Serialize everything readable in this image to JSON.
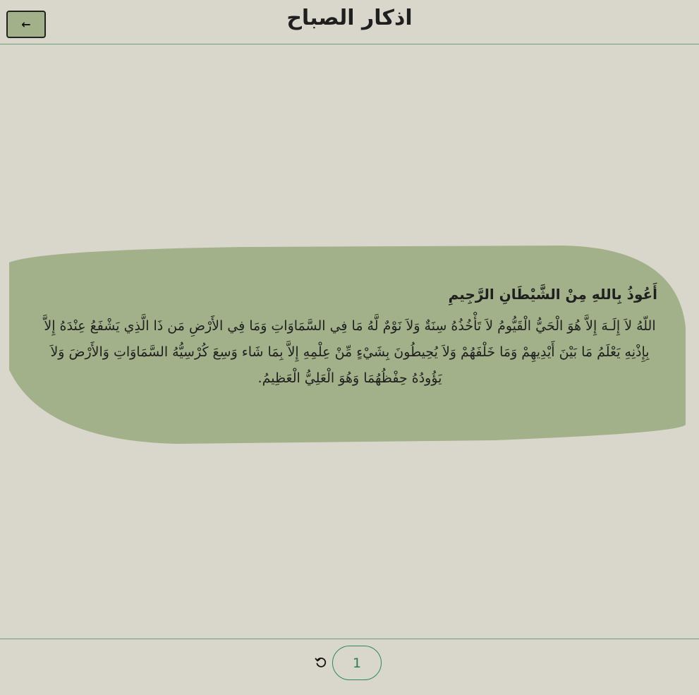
{
  "header": {
    "title": "اذكار الصباح",
    "back_label": "←"
  },
  "card": {
    "intro": "أَعُوذُ بِاللهِ مِنْ الشَّيْطَانِ الرَّجِيمِ",
    "body": "اللّهُ لاَ إِلَـهَ إِلاَّ هُوَ الْحَيُّ الْقَيُّومُ لاَ تَأْخُذُهُ سِنَةٌ وَلاَ نَوْمٌ لَّهُ مَا فِي السَّمَاوَاتِ وَمَا فِي الأَرْضِ مَن ذَا الَّذِي يَشْفَعُ عِنْدَهُ إِلاَّ بِإِذْنِهِ يَعْلَمُ مَا بَيْنَ أَيْدِيهِمْ وَمَا خَلْفَهُمْ وَلاَ يُحِيطُونَ بِشَيْءٍ مِّنْ عِلْمِهِ إِلاَّ بِمَا شَاء وَسِعَ كُرْسِيُّهُ السَّمَاوَاتِ وَالأَرْضَ وَلاَ يَؤُودُهُ حِفْظُهُمَا وَهُوَ الْعَلِيُّ الْعَظِيمُ.",
    "color": "#a3b18a"
  },
  "footer": {
    "counter": "1",
    "reset_icon": "reset-icon"
  },
  "colors": {
    "background": "#d9d7cc",
    "accent": "#6b9e7d",
    "counter_text": "#2e7d4f"
  }
}
